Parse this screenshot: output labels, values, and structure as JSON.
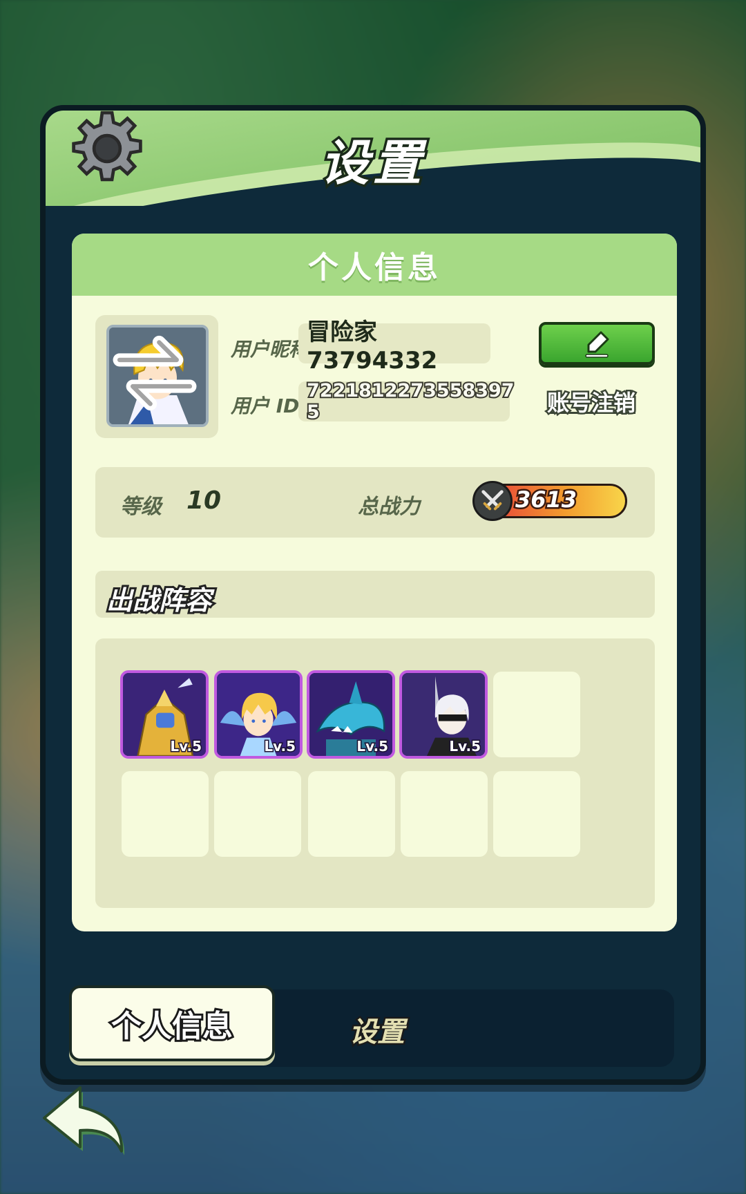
{
  "window": {
    "title": "设置"
  },
  "profile": {
    "section_title": "个人信息",
    "nickname_label": "用户昵称",
    "nickname_value": "冒险家73794332",
    "id_label": "用户  ID",
    "id_value": "7221812273558397​5",
    "logout_label": "账号注销"
  },
  "stats": {
    "level_label": "等级",
    "level_value": "10",
    "power_label": "总战力",
    "power_value": "3613"
  },
  "lineup": {
    "title": "出战阵容",
    "heroes": [
      {
        "level": "Lv.5",
        "portrait": "golden-armored-knight"
      },
      {
        "level": "Lv.5",
        "portrait": "blonde-fairy-girl"
      },
      {
        "level": "Lv.5",
        "portrait": "blue-shark-warrior"
      },
      {
        "level": "Lv.5",
        "portrait": "white-haired-swordswoman"
      }
    ],
    "empty_slots": 6
  },
  "tabs": {
    "active": "个人信息",
    "inactive": "设置"
  },
  "colors": {
    "header_green": "#a6da85",
    "panel_bg": "#f6fbdc",
    "card_bg": "#e3e6c3",
    "hero_border": "#c05ae0",
    "edit_button": "#3aa52e",
    "window_bg": "#0e2a3a"
  },
  "icons": [
    "gear-icon",
    "avatar-swap-icon",
    "pencil-edit-icon",
    "crossed-swords-icon",
    "back-arrow-icon"
  ]
}
